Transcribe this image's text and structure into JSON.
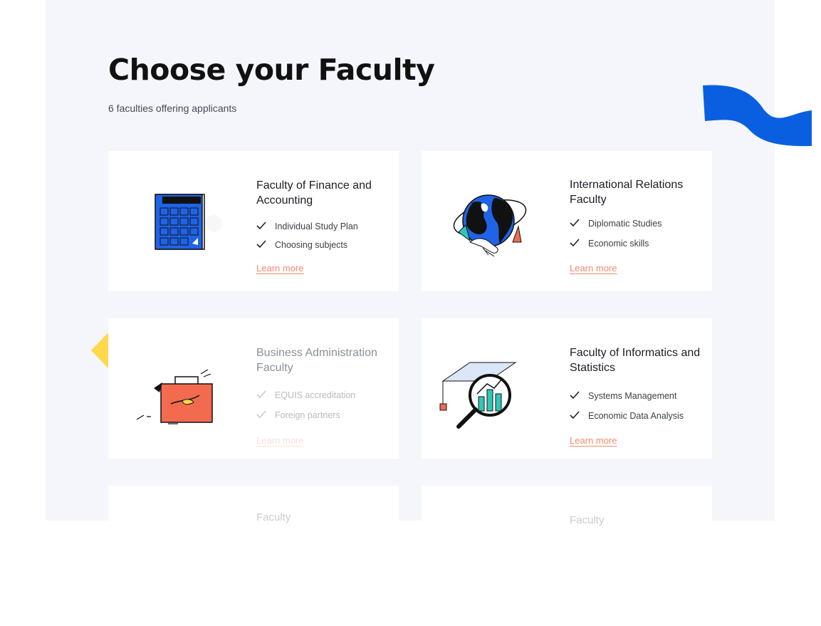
{
  "page": {
    "title": "Choose your Faculty",
    "subtitle": "6 faculties offering applicants"
  },
  "colors": {
    "accent_blue": "#0a5fe0",
    "accent_yellow": "#ffd84d",
    "link": "#f08a6e",
    "panel_bg": "#f4f6fb"
  },
  "cards": [
    {
      "name": "Faculty of Finance and Accounting",
      "icon": "calculator-icon",
      "features": [
        "Individual Study Plan",
        "Choosing subjects"
      ],
      "link": "Learn more"
    },
    {
      "name": "International Relations Faculty",
      "icon": "globe-handshake-icon",
      "features": [
        "Diplomatic Studies",
        "Economic skills"
      ],
      "link": "Learn more"
    },
    {
      "name": "Business Administration Faculty",
      "icon": "briefcase-icon",
      "features": [
        "EQUIS accreditation",
        "Foreign partners"
      ],
      "link": "Learn more"
    },
    {
      "name": "Faculty of Informatics and Statistics",
      "icon": "graduation-magnifier-icon",
      "features": [
        "Systems Management",
        "Economic Data Analysis"
      ],
      "link": "Learn more"
    },
    {
      "name": "Faculty",
      "partial": true
    },
    {
      "name": "Faculty",
      "partial": true
    }
  ]
}
